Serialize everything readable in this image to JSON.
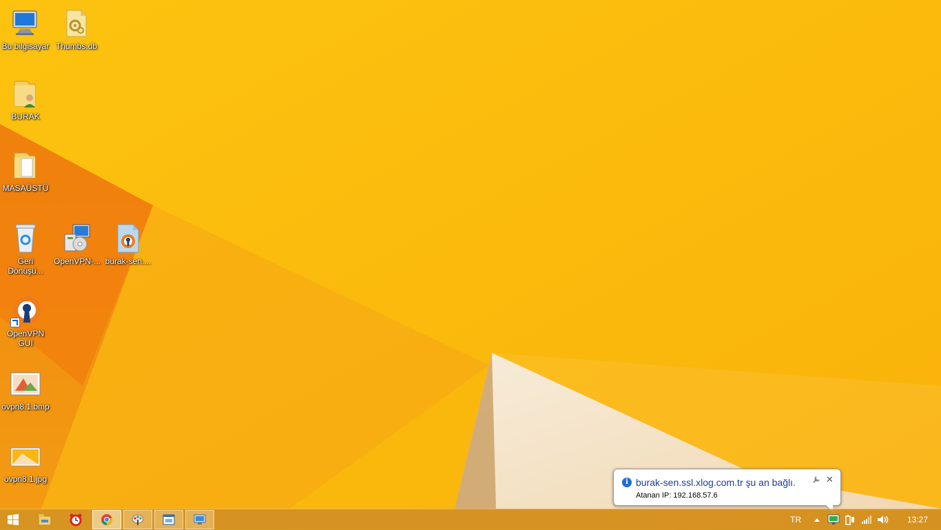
{
  "desktop": {
    "icons": [
      {
        "label": "Bu bilgisayar",
        "icon": "computer-icon"
      },
      {
        "label": "Thumbs.db",
        "icon": "system-file-icon"
      },
      {
        "label": "BURAK",
        "icon": "user-folder-icon"
      },
      {
        "label": "MASAÜSTÜ",
        "icon": "folder-icon"
      },
      {
        "label": "Geri Dönüşü...",
        "icon": "recycle-bin-icon"
      },
      {
        "label": "OpenVPN-...",
        "icon": "installer-icon"
      },
      {
        "label": "burak-sen....",
        "icon": "openvpn-config-icon"
      },
      {
        "label": "OpenVPN GUI",
        "icon": "openvpn-gui-icon"
      },
      {
        "label": "ovpn8.1.bmp",
        "icon": "bitmap-image-icon"
      },
      {
        "label": "ovpn8.1.jpg",
        "icon": "jpeg-image-icon"
      }
    ]
  },
  "taskbar": {
    "start_icon": "windows-start-icon",
    "pinned": [
      {
        "icon": "file-explorer-icon",
        "state": "pinned"
      },
      {
        "icon": "alarm-clock-icon",
        "state": "pinned"
      },
      {
        "icon": "chrome-icon",
        "state": "active"
      },
      {
        "icon": "paint-icon",
        "state": "open"
      },
      {
        "icon": "window-app-icon",
        "state": "open"
      },
      {
        "icon": "remote-desktop-icon",
        "state": "open"
      }
    ],
    "tray": {
      "language": "TR",
      "clock": "13:27"
    }
  },
  "notification": {
    "title": "burak-sen.ssl.xlog.com.tr şu an bağlı.",
    "body": "Atanan IP: 192.168.57.6",
    "close_glyph": "✕"
  },
  "colors": {
    "wallpaper": "#fbb40a",
    "taskbar": "#cd8c28",
    "balloon_title": "#1a3c9a"
  }
}
